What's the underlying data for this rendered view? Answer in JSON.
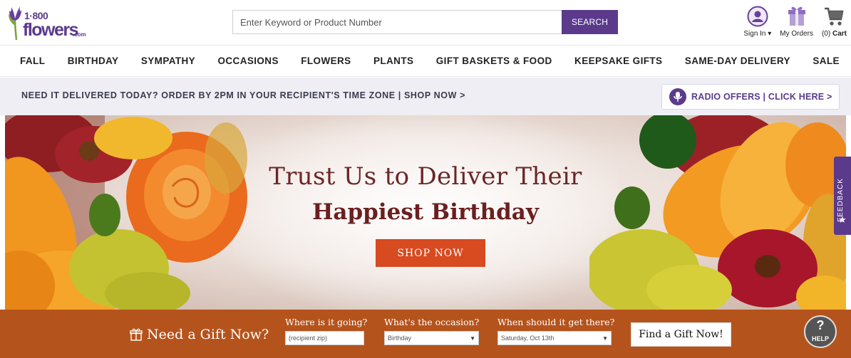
{
  "brand": {
    "line1": "1·800",
    "line2": "flowers",
    "suffix": ".com",
    "color": "#5b3a8c"
  },
  "search": {
    "placeholder": "Enter Keyword or Product Number",
    "button_label": "SEARCH"
  },
  "header_links": [
    {
      "icon": "user-icon",
      "label": "Sign In ▾"
    },
    {
      "icon": "gift-box-icon",
      "label": "My Orders"
    },
    {
      "icon": "cart-icon",
      "count": "(0)",
      "label": "Cart"
    }
  ],
  "nav": [
    "FALL",
    "BIRTHDAY",
    "SYMPATHY",
    "OCCASIONS",
    "FLOWERS",
    "PLANTS",
    "GIFT BASKETS & FOOD",
    "KEEPSAKE GIFTS",
    "SAME-DAY DELIVERY",
    "SALE"
  ],
  "promo": {
    "text": "NEED IT DELIVERED TODAY? ORDER BY 2PM IN YOUR RECIPIENT'S TIME ZONE | SHOP NOW >",
    "radio_label": "RADIO OFFERS | CLICK HERE >",
    "radio_icon": "microphone-icon"
  },
  "hero": {
    "line1": "Trust Us to Deliver Their",
    "line2": "Happiest Birthday",
    "cta": "SHOP NOW",
    "cta_color": "#d84a1f"
  },
  "feedback": {
    "label": "FEEDBACK",
    "icon": "star-icon"
  },
  "gift_finder": {
    "title": "Need a Gift Now?",
    "zip": {
      "label": "Where is it going?",
      "placeholder": "(recipient zip)"
    },
    "occasion": {
      "label": "What's the occasion?",
      "value": "Birthday"
    },
    "date": {
      "label": "When should it get there?",
      "value": "Saturday, Oct 13th"
    },
    "button": "Find a Gift Now!",
    "bg_color": "#b5531c"
  },
  "help": {
    "label": "HELP",
    "glyph": "?"
  }
}
